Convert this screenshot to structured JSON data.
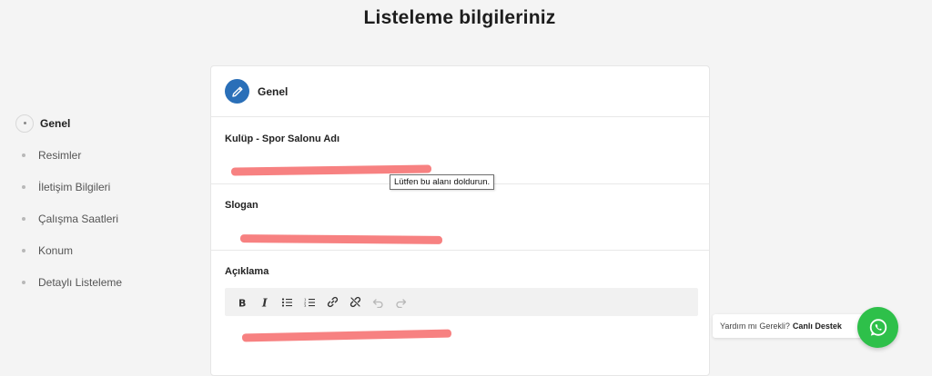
{
  "page": {
    "title": "Listeleme bilgileriniz"
  },
  "steps": [
    {
      "label": "Genel",
      "active": true
    },
    {
      "label": "Resimler"
    },
    {
      "label": "İletişim Bilgileri"
    },
    {
      "label": "Çalışma Saatleri"
    },
    {
      "label": "Konum"
    },
    {
      "label": "Detaylı Listeleme"
    }
  ],
  "card": {
    "title": "Genel",
    "icon": "pencil-icon",
    "accent": "#2a6fb8",
    "fields": {
      "name": {
        "label": "Kulüp - Spor Salonu Adı",
        "value": ""
      },
      "slogan": {
        "label": "Slogan",
        "value": ""
      },
      "description": {
        "label": "Açıklama"
      }
    },
    "validation_tooltip": "Lütfen bu alanı doldurun.",
    "toolbar": [
      "bold-icon",
      "italic-icon",
      "bullet-list-icon",
      "numbered-list-icon",
      "link-icon",
      "unlink-icon",
      "undo-icon",
      "redo-icon"
    ]
  },
  "help": {
    "prefix": "Yardım mı Gerekli?",
    "link": "Canlı Destek",
    "button_color": "#2ec04a",
    "icon": "whatsapp-icon"
  }
}
